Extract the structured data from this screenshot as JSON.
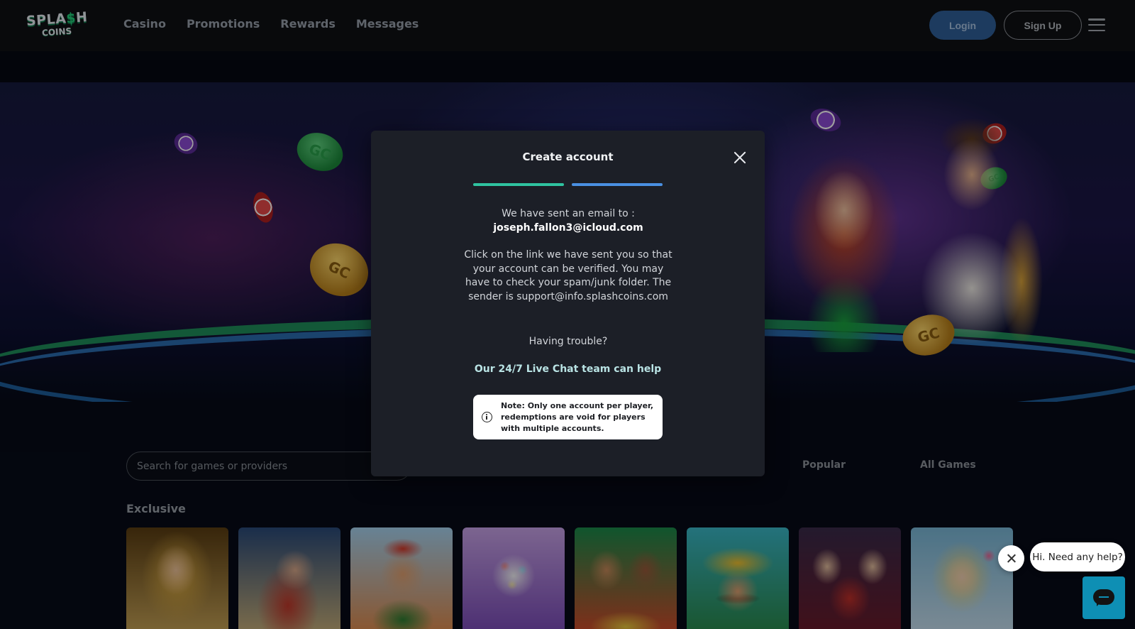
{
  "logo": {
    "line1_a": "SPLA",
    "line1_dollar": "$",
    "line1_b": "H",
    "line2": "COINS"
  },
  "nav": {
    "items": [
      {
        "label": "Casino"
      },
      {
        "label": "Promotions"
      },
      {
        "label": "Rewards"
      },
      {
        "label": "Messages"
      }
    ]
  },
  "auth": {
    "login_label": "Login",
    "signup_label": "Sign Up"
  },
  "search": {
    "placeholder": "Search for games or providers"
  },
  "filters": [
    {
      "label": "Popular"
    },
    {
      "label": "All Games"
    }
  ],
  "sections": {
    "exclusive_title": "Exclusive"
  },
  "hero_coins": {
    "label": "GC"
  },
  "modal": {
    "title": "Create account",
    "progress": {
      "steps_total": 2,
      "steps_completed": 2,
      "step_colors": [
        "#2fc3a0",
        "#4a90e2"
      ]
    },
    "sent_line": "We have sent an email to :",
    "email": "joseph.fallon3@icloud.com",
    "instructions": "Click on the link we have sent you so that your account can be verified. You may have to check your spam/junk folder. The sender is support@info.splashcoins.com",
    "trouble": "Having trouble?",
    "chat_link": "Our 24/7 Live Chat team can help",
    "note": "Note: Only one account per player, redemptions are void for players with multiple accounts."
  },
  "chat_widget": {
    "bubble_text": "Hi. Need any help?"
  },
  "colors": {
    "accent_green": "#22d07a",
    "login_blue": "#2f5f99",
    "chat_blue": "#0e8fb4",
    "modal_bg": "#1c1f27"
  },
  "icons": {
    "close": "close-icon",
    "info": "info-icon",
    "menu": "hamburger-menu-icon",
    "chat": "chat-icon"
  },
  "game_tiles": [
    {
      "name": "golden-woman"
    },
    {
      "name": "thunder-god"
    },
    {
      "name": "fisherman"
    },
    {
      "name": "gumball-candy"
    },
    {
      "name": "samba-dancers"
    },
    {
      "name": "mexican-sombrero"
    },
    {
      "name": "witches-trio"
    },
    {
      "name": "fairy-princess"
    }
  ]
}
